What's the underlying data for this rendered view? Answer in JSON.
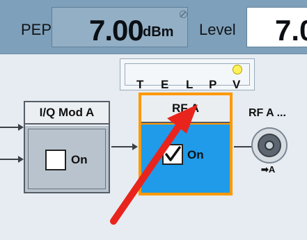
{
  "status_bar": {
    "pep_label": "PEP",
    "pep_value": "7.00",
    "pep_unit": "dBm",
    "level_label": "Level",
    "level_value": "7.0"
  },
  "telpv": {
    "letters": [
      "T",
      "E",
      "L",
      "P",
      "V"
    ],
    "indicator_color": "#fff15a"
  },
  "iq_mod_block": {
    "title": "I/Q Mod A",
    "checkbox_label": "On",
    "checked": false
  },
  "rf_block": {
    "title": "RF A",
    "checkbox_label": "On",
    "checked": true,
    "highlight_color": "#ff9900",
    "body_color": "#1f9bea"
  },
  "rf_output": {
    "label": "RF A ...",
    "sub_label": "➡A"
  },
  "colors": {
    "topbar": "#7fa0ba",
    "background": "#e6ecf2",
    "annotation_arrow": "#e8241c"
  }
}
